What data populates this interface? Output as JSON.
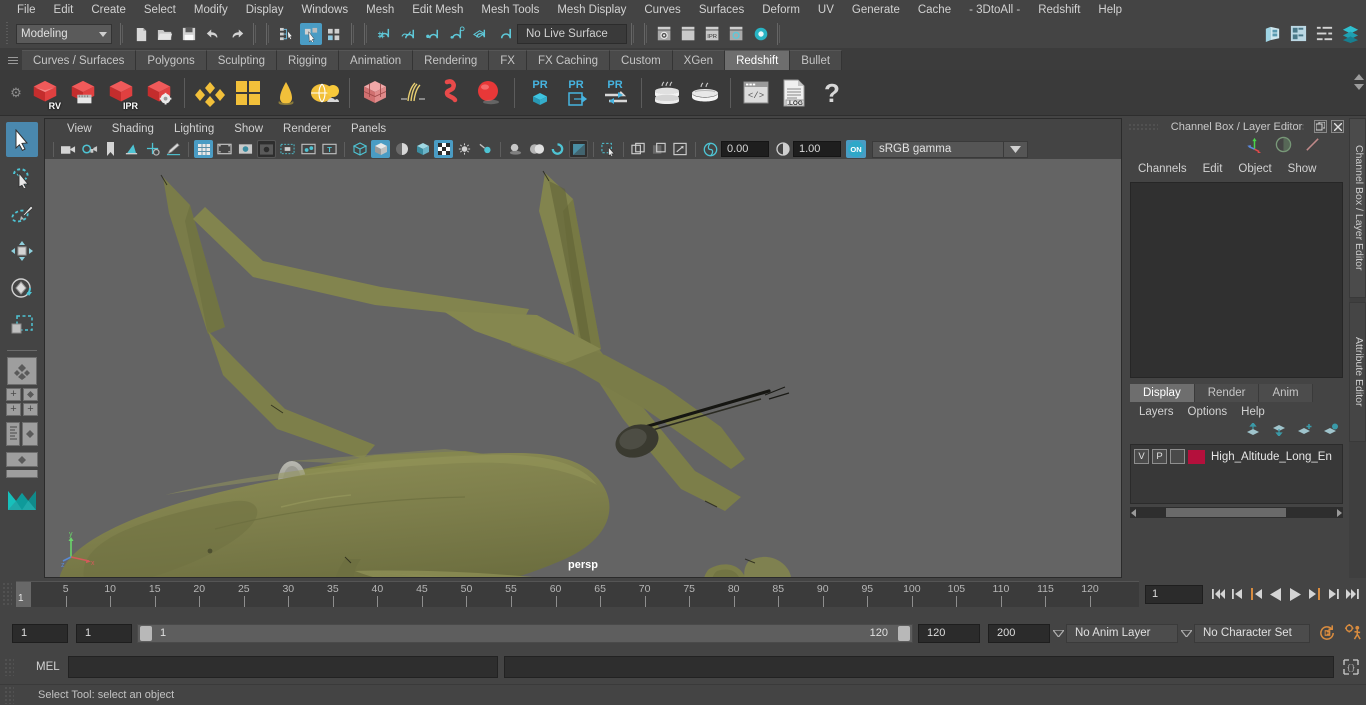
{
  "app": {
    "title": "Autodesk Maya",
    "accent_blue": "#4a9cc4",
    "accent_orange": "#d98c3f",
    "bg": "#444444"
  },
  "menubar": {
    "items": [
      {
        "label": "File"
      },
      {
        "label": "Edit"
      },
      {
        "label": "Create"
      },
      {
        "label": "Select"
      },
      {
        "label": "Modify"
      },
      {
        "label": "Display"
      },
      {
        "label": "Windows"
      },
      {
        "label": "Mesh"
      },
      {
        "label": "Edit Mesh"
      },
      {
        "label": "Mesh Tools"
      },
      {
        "label": "Mesh Display"
      },
      {
        "label": "Curves"
      },
      {
        "label": "Surfaces"
      },
      {
        "label": "Deform"
      },
      {
        "label": "UV"
      },
      {
        "label": "Generate"
      },
      {
        "label": "Cache"
      },
      {
        "label": "- 3DtoAll -"
      },
      {
        "label": "Redshift"
      },
      {
        "label": "Help"
      }
    ]
  },
  "statusline": {
    "mode": "Modeling",
    "live_surface": "No Live Surface",
    "icons": [
      "new-scene-icon",
      "open-scene-icon",
      "save-scene-icon",
      "undo-icon",
      "redo-icon",
      "select-hierarchy-icon",
      "select-object-icon",
      "select-component-icon",
      "snap-grid-icon",
      "snap-curve-icon",
      "snap-point-icon",
      "snap-projected-center-icon",
      "snap-view-plane-icon",
      "make-live-icon"
    ],
    "right_icons": [
      "show-hide-editor-icon",
      "attribute-editor-icon",
      "tool-settings-icon",
      "channel-box-icon"
    ]
  },
  "shelf": {
    "tabs": [
      {
        "label": "Curves / Surfaces",
        "active": false
      },
      {
        "label": "Polygons",
        "active": false
      },
      {
        "label": "Sculpting",
        "active": false
      },
      {
        "label": "Rigging",
        "active": false
      },
      {
        "label": "Animation",
        "active": false
      },
      {
        "label": "Rendering",
        "active": false
      },
      {
        "label": "FX",
        "active": false
      },
      {
        "label": "FX Caching",
        "active": false
      },
      {
        "label": "Custom",
        "active": false
      },
      {
        "label": "XGen",
        "active": false
      },
      {
        "label": "Redshift",
        "active": true
      },
      {
        "label": "Bullet",
        "active": false
      }
    ],
    "buttons": [
      {
        "name": "redshift-render-view-icon",
        "label": "RV"
      },
      {
        "name": "redshift-render-sequence-icon",
        "label": ""
      },
      {
        "name": "redshift-ipr-icon",
        "label": "IPR"
      },
      {
        "name": "redshift-render-settings-icon",
        "label": ""
      },
      {
        "name": "redshift-material-icon",
        "label": ""
      },
      {
        "name": "redshift-material-blender-icon",
        "label": ""
      },
      {
        "name": "redshift-light-cone-icon",
        "label": ""
      },
      {
        "name": "redshift-dome-light-icon",
        "label": ""
      },
      {
        "name": "redshift-proxy-icon",
        "label": ""
      },
      {
        "name": "redshift-hair-icon",
        "label": ""
      },
      {
        "name": "redshift-volume-icon",
        "label": ""
      },
      {
        "name": "redshift-sphere-icon",
        "label": ""
      },
      {
        "name": "redshift-pr-object-icon",
        "label": "PR"
      },
      {
        "name": "redshift-pr-export-icon",
        "label": "PR"
      },
      {
        "name": "redshift-pr-transfer-icon",
        "label": "PR"
      },
      {
        "name": "redshift-bake-set-icon",
        "label": ""
      },
      {
        "name": "redshift-bake-icon",
        "label": ""
      },
      {
        "name": "redshift-script-editor-icon",
        "label": ""
      },
      {
        "name": "redshift-log-icon",
        "label": ".LOG"
      },
      {
        "name": "redshift-help-icon",
        "label": "?"
      }
    ]
  },
  "toolbox": {
    "tools": [
      {
        "name": "select-tool",
        "label": "Select Tool",
        "active": true
      },
      {
        "name": "lasso-select-tool",
        "label": "Lasso Select Tool",
        "active": false
      },
      {
        "name": "paint-select-tool",
        "label": "Paint Select Tool",
        "active": false
      },
      {
        "name": "move-tool",
        "label": "Move Tool",
        "active": false
      },
      {
        "name": "rotate-tool",
        "label": "Rotate Tool",
        "active": false
      },
      {
        "name": "scale-tool",
        "label": "Scale Tool",
        "active": false
      }
    ],
    "layouts": [
      "single-perspective-layout",
      "four-view-layout",
      "outliner-persp-layout",
      "hypershade-persp-layout"
    ],
    "logo": "maya-logo"
  },
  "viewport": {
    "menus": [
      {
        "label": "View"
      },
      {
        "label": "Shading"
      },
      {
        "label": "Lighting"
      },
      {
        "label": "Show"
      },
      {
        "label": "Renderer"
      },
      {
        "label": "Panels"
      }
    ],
    "camera_label": "persp",
    "exposure": "0.00",
    "gamma": "1.00",
    "color_management_toggle": "ON",
    "color_profile": "sRGB gamma",
    "model": {
      "name": "High Altitude Long Endurance UAV",
      "body_color": "#7e7f4a",
      "shadow_color": "#646464",
      "background_color": "#646464"
    },
    "toolbar_icons": [
      "select-camera-icon",
      "camera-attributes-icon",
      "bookmark-icon",
      "image-plane-icon",
      "2d-pan-zoom-icon",
      "grease-pencil-icon",
      "grid-toggle-icon",
      "film-gate-icon",
      "resolution-gate-icon",
      "gate-mask-icon",
      "field-chart-icon",
      "safe-action-icon",
      "safe-title-icon",
      "wireframe-icon",
      "smooth-shade-all-icon",
      "smooth-shade-selected-icon",
      "flat-shade-icon",
      "shaded-wireframe-icon",
      "use-default-light-icon",
      "use-all-lights-icon",
      "shadows-icon",
      "screen-space-ao-icon",
      "motion-blur-icon",
      "multisample-icon",
      "isolate-select-icon",
      "xray-icon",
      "xray-joints-icon",
      "xray-active-icon"
    ]
  },
  "channel_box": {
    "title": "Channel Box / Layer Editor",
    "window_buttons": [
      "undock-icon",
      "close-icon"
    ],
    "toolbar_icons": [
      "channel-box-icon",
      "attribute-editor-icon",
      "modeling-toolkit-icon"
    ],
    "menus": [
      {
        "label": "Channels"
      },
      {
        "label": "Edit"
      },
      {
        "label": "Object"
      },
      {
        "label": "Show"
      }
    ],
    "empty": true
  },
  "layer_editor": {
    "tabs": [
      {
        "label": "Display",
        "active": true
      },
      {
        "label": "Render",
        "active": false
      },
      {
        "label": "Anim",
        "active": false
      }
    ],
    "menus": [
      {
        "label": "Layers"
      },
      {
        "label": "Options"
      },
      {
        "label": "Help"
      }
    ],
    "buttons": [
      "move-layer-up-icon",
      "move-layer-down-icon",
      "new-layer-icon",
      "new-layer-from-selected-icon"
    ],
    "layers": [
      {
        "visibility": "V",
        "playback": "P",
        "state": "",
        "color": "#b4103c",
        "name": "High_Altitude_Long_En"
      }
    ]
  },
  "vertical_tabs": [
    {
      "label": "Channel Box / Layer Editor"
    },
    {
      "label": "Attribute Editor"
    }
  ],
  "timeline": {
    "start": 1,
    "end": 120,
    "current_frame": "1",
    "playback_frame_field": "1",
    "tick_labels": [
      5,
      10,
      15,
      20,
      25,
      30,
      35,
      40,
      45,
      50,
      55,
      60,
      65,
      70,
      75,
      80,
      85,
      90,
      95,
      100,
      105,
      110,
      115,
      120
    ],
    "controls": [
      "go-to-start-icon",
      "step-back-frame-icon",
      "step-back-key-icon",
      "play-backwards-icon",
      "play-forwards-icon",
      "step-forward-key-icon",
      "step-forward-frame-icon",
      "go-to-end-icon"
    ]
  },
  "range_slider": {
    "anim_start": "1",
    "range_start": "1",
    "slider_start_label": "1",
    "slider_end_label": "120",
    "range_end": "120",
    "anim_end": "200",
    "anim_layer": "No Anim Layer",
    "character_set": "No Character Set",
    "right_icons": [
      "auto-key-icon",
      "animation-preferences-icon"
    ]
  },
  "command_line": {
    "language_label": "MEL",
    "input_value": "",
    "output_value": "",
    "script_editor_icon": "script-editor-icon"
  },
  "help_line": {
    "text": "Select Tool: select an object"
  }
}
